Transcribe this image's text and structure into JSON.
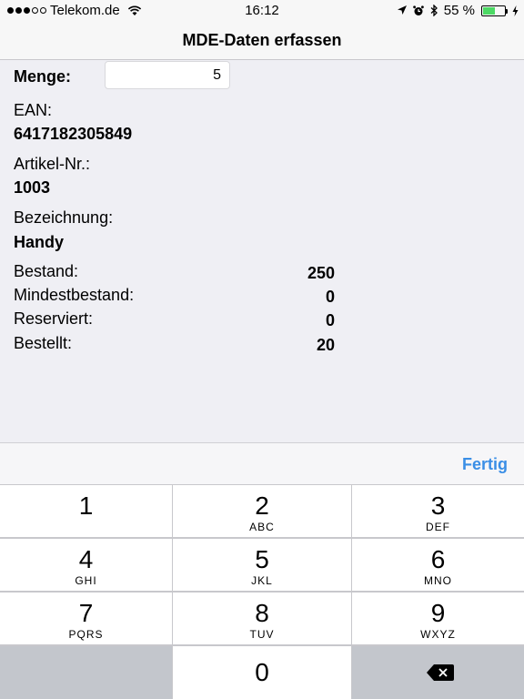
{
  "status_bar": {
    "carrier": "Telekom.de",
    "time": "16:12",
    "battery_percent": "55 %",
    "battery_level": 0.55,
    "signal_bars_filled": 3,
    "signal_bars_total": 5,
    "icons": [
      "wifi-icon",
      "location-arrow-icon",
      "alarm-icon",
      "bluetooth-icon",
      "battery-icon",
      "charging-icon"
    ]
  },
  "nav": {
    "title": "MDE-Daten erfassen"
  },
  "form": {
    "menge_label": "Menge:",
    "menge_value": "5",
    "ean_label": "EAN:",
    "ean_value": "6417182305849",
    "artikel_label": "Artikel-Nr.:",
    "artikel_value": "1003",
    "bezeichnung_label": "Bezeichnung:",
    "bezeichnung_value": "Handy",
    "stock": [
      {
        "label": "Bestand:",
        "value": "250"
      },
      {
        "label": "Mindestbestand:",
        "value": "0"
      },
      {
        "label": "Reserviert:",
        "value": "0"
      },
      {
        "label": "Bestellt:",
        "value": "20"
      }
    ]
  },
  "toolbar": {
    "done_label": "Fertig"
  },
  "keypad": {
    "keys": [
      {
        "digit": "1",
        "letters": ""
      },
      {
        "digit": "2",
        "letters": "ABC"
      },
      {
        "digit": "3",
        "letters": "DEF"
      },
      {
        "digit": "4",
        "letters": "GHI"
      },
      {
        "digit": "5",
        "letters": "JKL"
      },
      {
        "digit": "6",
        "letters": "MNO"
      },
      {
        "digit": "7",
        "letters": "PQRS"
      },
      {
        "digit": "8",
        "letters": "TUV"
      },
      {
        "digit": "9",
        "letters": "WXYZ"
      },
      {
        "digit": "0",
        "letters": ""
      }
    ]
  },
  "colors": {
    "accent": "#3a8ee6",
    "battery_fill": "#4cd964",
    "background": "#efeff4"
  }
}
